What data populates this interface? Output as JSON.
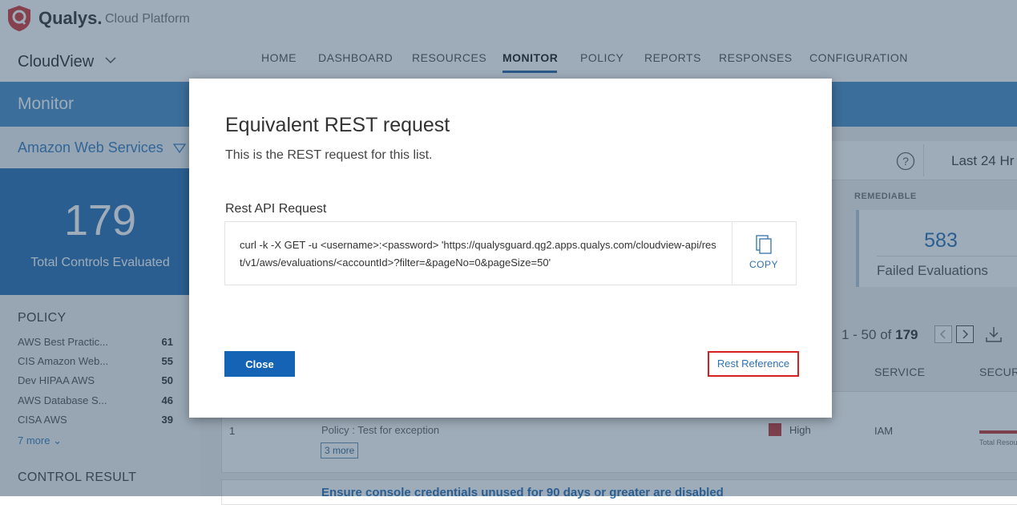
{
  "header": {
    "brand": "Qualys.",
    "platform": "Cloud Platform",
    "app_name": "CloudView"
  },
  "nav": {
    "items": [
      "HOME",
      "DASHBOARD",
      "RESOURCES",
      "MONITOR",
      "POLICY",
      "REPORTS",
      "RESPONSES",
      "CONFIGURATION"
    ],
    "active": "MONITOR"
  },
  "page": {
    "title": "Monitor"
  },
  "sidebar": {
    "provider": "Amazon Web Services",
    "kpi": {
      "value": "179",
      "label": "Total Controls Evaluated"
    },
    "policy_heading": "POLICY",
    "policies": [
      {
        "name": "AWS Best Practic...",
        "count": "61"
      },
      {
        "name": "CIS Amazon Web...",
        "count": "55"
      },
      {
        "name": "Dev HIPAA AWS",
        "count": "50"
      },
      {
        "name": "AWS Database S...",
        "count": "46"
      },
      {
        "name": "CISA AWS",
        "count": "39"
      }
    ],
    "more_label": "7 more",
    "control_result_heading": "CONTROL RESULT"
  },
  "main": {
    "time_range": "Last 24 Hr",
    "remediable_heading": "REMEDIABLE",
    "failed": {
      "value": "583",
      "label": "Failed Evaluations"
    },
    "pager": {
      "range": "1 - 50 of",
      "total": "179"
    },
    "columns": {
      "service": "SERVICE",
      "security": "SECURITY"
    },
    "rows": [
      {
        "num": "1",
        "policy": "Policy : Test for exception",
        "more": "3 more",
        "severity": "High",
        "service": "IAM",
        "bar_label": "Total Resources"
      }
    ],
    "next_row_title": "Ensure console credentials unused for 90 days or greater are disabled"
  },
  "modal": {
    "title": "Equivalent REST request",
    "subtitle": "This is the REST request for this list.",
    "label": "Rest API Request",
    "request": "curl -k -X GET -u <username>:<password> 'https://qualysguard.qg2.apps.qualys.com/cloudview-api/rest/v1/aws/evaluations/<accountId>?filter=&pageNo=0&pageSize=50'",
    "copy_label": "COPY",
    "close_label": "Close",
    "reference_label": "Rest Reference"
  },
  "colors": {
    "accent": "#1563b5",
    "title_bar": "#4d8ec9",
    "kpi_bg": "#2f72b4",
    "highlight_border": "#d62020",
    "severity_high": "#c23b3b"
  }
}
